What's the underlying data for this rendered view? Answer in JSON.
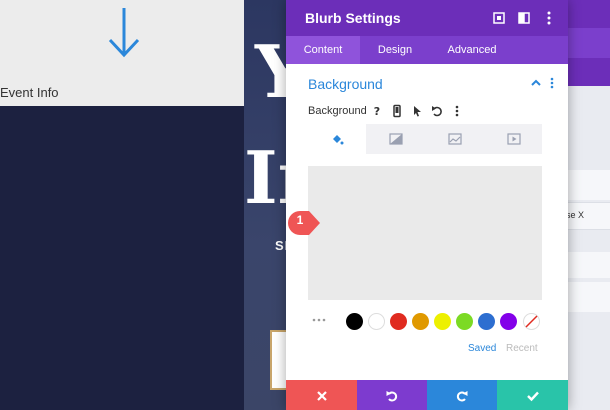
{
  "left": {
    "arrow_icon": "arrow-down-icon",
    "event_label": "Event Info"
  },
  "backdrop": {
    "letter_y": "Y",
    "letter_i": "In",
    "small_text": "SE",
    "right_row_text": "se X"
  },
  "modal": {
    "title": "Blurb Settings",
    "header_icons": [
      "fullscreen-icon",
      "split-view-icon",
      "more-icon"
    ],
    "tabs": [
      {
        "label": "Content",
        "active": true
      },
      {
        "label": "Design",
        "active": false
      },
      {
        "label": "Advanced",
        "active": false
      }
    ],
    "section": {
      "title": "Background",
      "collapse_icon": "chevron-up-icon",
      "menu_icon": "more-vertical-icon"
    },
    "field": {
      "label": "Background",
      "icons": [
        "help-icon",
        "mobile-icon",
        "cursor-icon",
        "undo-icon",
        "more-vertical-icon"
      ]
    },
    "background_types": [
      "color-fill-icon",
      "gradient-icon",
      "image-icon",
      "video-icon"
    ],
    "swatches": [
      {
        "name": "black",
        "color": "#000000"
      },
      {
        "name": "white",
        "color": "#ffffff"
      },
      {
        "name": "red",
        "color": "#e02b20"
      },
      {
        "name": "orange",
        "color": "#e09900"
      },
      {
        "name": "yellow",
        "color": "#edf000"
      },
      {
        "name": "green",
        "color": "#7cda24"
      },
      {
        "name": "blue",
        "color": "#2d6ed0"
      },
      {
        "name": "purple",
        "color": "#8300e9"
      },
      {
        "name": "none",
        "color": "transparent"
      }
    ],
    "swatch_tabs": {
      "saved": "Saved",
      "recent": "Recent"
    },
    "footer": {
      "close_icon": "close-icon",
      "undo_icon": "undo-icon",
      "redo_icon": "redo-icon",
      "save_icon": "check-icon"
    }
  },
  "annotation": {
    "number": "1",
    "color": "#ef5555"
  },
  "colors": {
    "accent": "#6c2eb9",
    "tab_bar": "#7b3fcc",
    "link": "#2b87da",
    "close": "#ef5555",
    "redo": "#2b87da",
    "save": "#29c4a9"
  }
}
